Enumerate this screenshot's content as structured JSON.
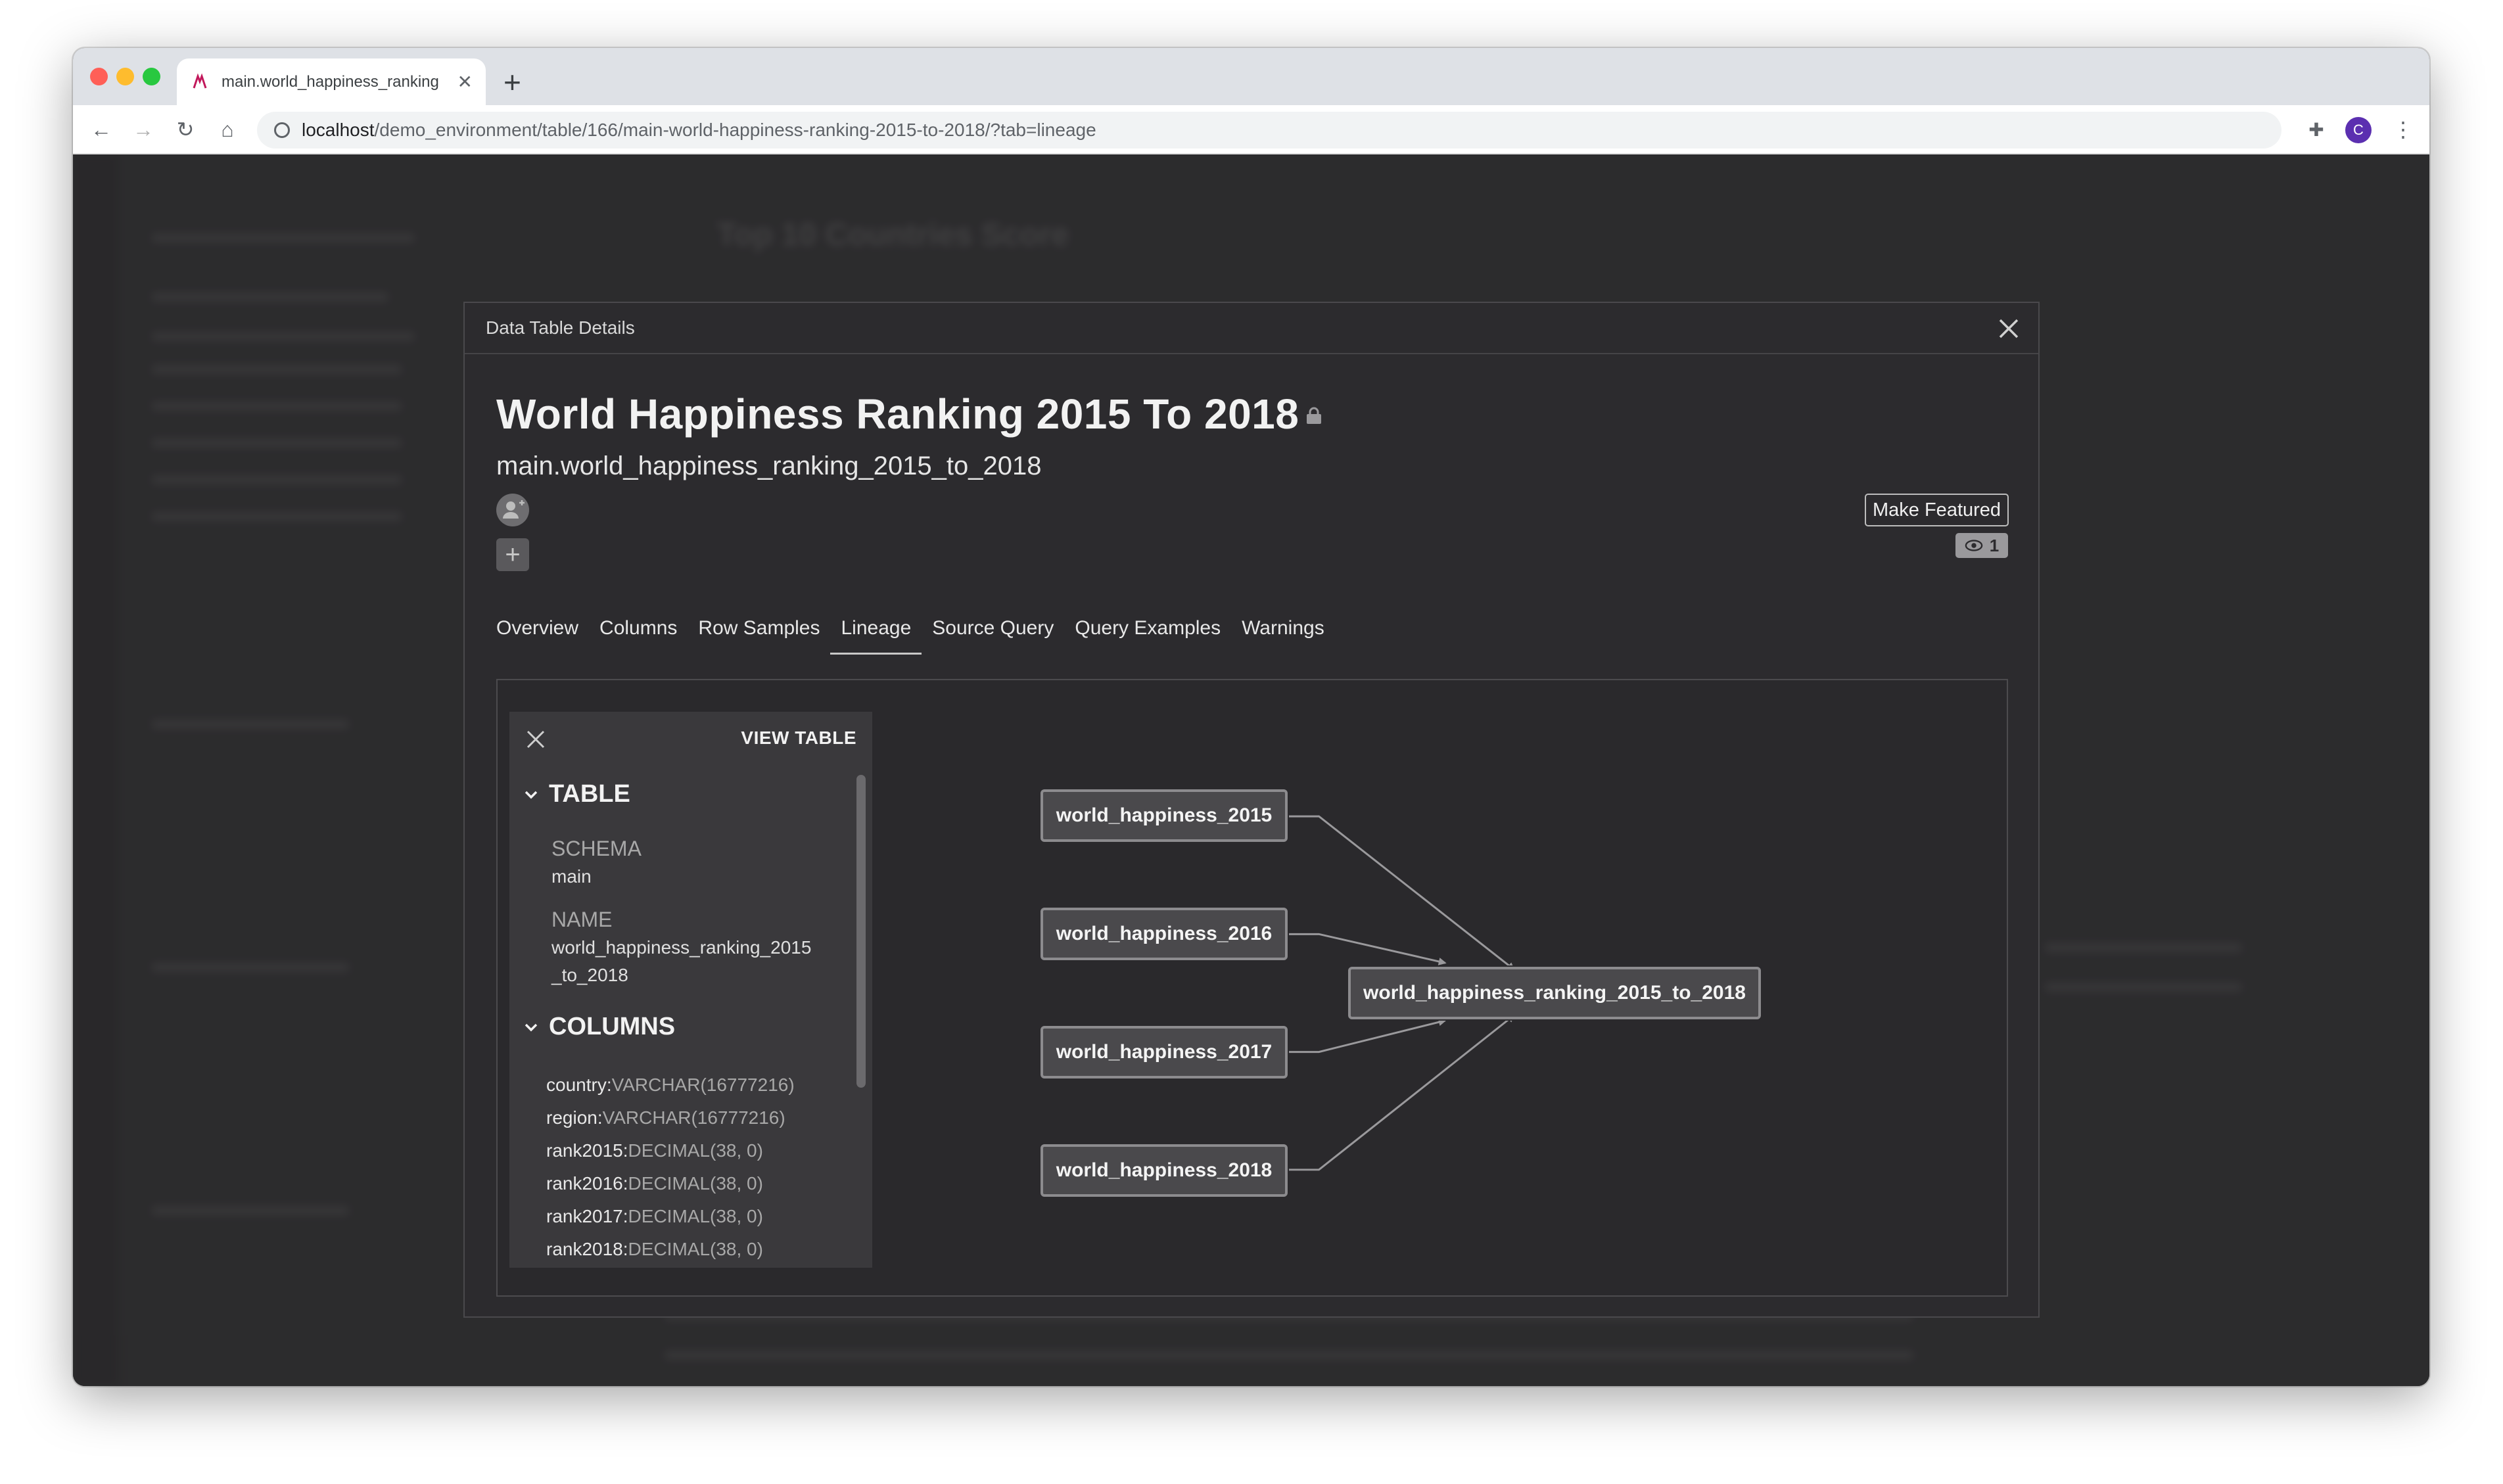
{
  "browser": {
    "tab_title": "main.world_happiness_ranking",
    "url_host": "localhost",
    "url_path": "/demo_environment/table/166/main-world-happiness-ranking-2015-to-2018/?tab=lineage",
    "profile_initial": "C"
  },
  "background": {
    "title": "Top 10 Countries Score"
  },
  "modal": {
    "header": "Data Table Details",
    "title": "World Happiness Ranking 2015 To 2018",
    "subtitle": "main.world_happiness_ranking_2015_to_2018",
    "make_featured": "Make Featured",
    "view_count": "1",
    "tabs": [
      {
        "label": "Overview"
      },
      {
        "label": "Columns"
      },
      {
        "label": "Row Samples"
      },
      {
        "label": "Lineage",
        "active": true
      },
      {
        "label": "Source Query"
      },
      {
        "label": "Query Examples"
      },
      {
        "label": "Warnings"
      }
    ]
  },
  "lineage": {
    "view_table": "VIEW TABLE",
    "table_section": "TABLE",
    "schema_label": "SCHEMA",
    "schema_value": "main",
    "name_label": "NAME",
    "name_value": "world_happiness_ranking_2015_to_2018",
    "columns_section": "COLUMNS",
    "columns": [
      {
        "name": "country:",
        "type": "VARCHAR(16777216)"
      },
      {
        "name": "region:",
        "type": "VARCHAR(16777216)"
      },
      {
        "name": "rank2015:",
        "type": "DECIMAL(38, 0)"
      },
      {
        "name": "rank2016:",
        "type": "DECIMAL(38, 0)"
      },
      {
        "name": "rank2017:",
        "type": "DECIMAL(38, 0)"
      },
      {
        "name": "rank2018:",
        "type": "DECIMAL(38, 0)"
      }
    ],
    "sources": [
      {
        "label": "world_happiness_2015"
      },
      {
        "label": "world_happiness_2016"
      },
      {
        "label": "world_happiness_2017"
      },
      {
        "label": "world_happiness_2018"
      }
    ],
    "target": {
      "label": "world_happiness_ranking_2015_to_2018"
    }
  },
  "colors": {
    "modal_bg": "#2c2b2e",
    "node_border": "#8c8b8e",
    "edge": "#9a999c"
  }
}
